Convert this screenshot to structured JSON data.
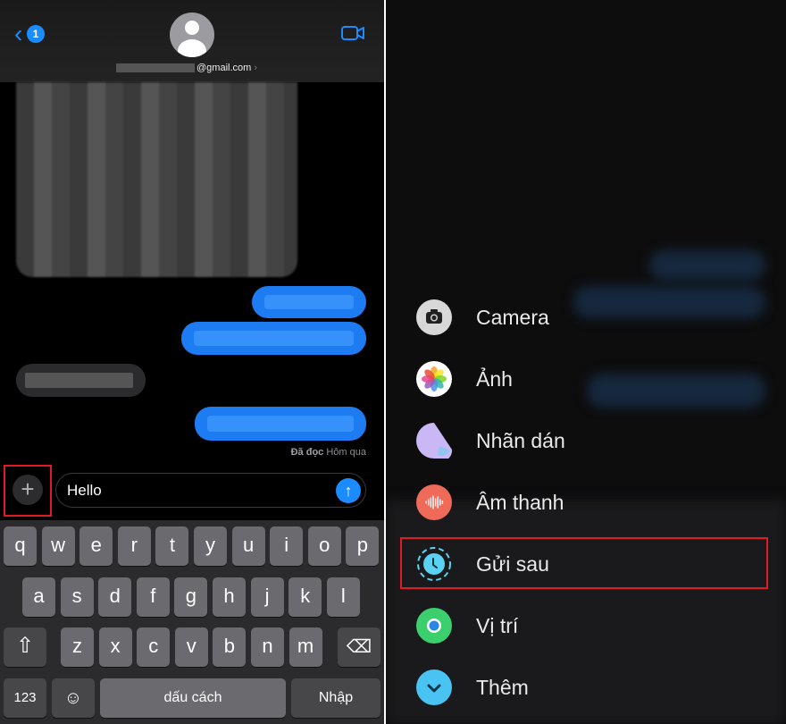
{
  "chat": {
    "back_badge": "1",
    "contact_email": "@gmail.com",
    "read_receipt_label": "Đã đọc",
    "read_receipt_time": "Hôm qua",
    "input_value": "Hello"
  },
  "keyboard": {
    "row1": [
      "q",
      "w",
      "e",
      "r",
      "t",
      "y",
      "u",
      "i",
      "o",
      "p"
    ],
    "row2": [
      "a",
      "s",
      "d",
      "f",
      "g",
      "h",
      "j",
      "k",
      "l"
    ],
    "row3": [
      "z",
      "x",
      "c",
      "v",
      "b",
      "n",
      "m"
    ],
    "numbers_key": "123",
    "space_key": "dấu cách",
    "return_key": "Nhập"
  },
  "apps_menu": {
    "items": [
      {
        "label": "Camera",
        "icon": "camera-icon",
        "color": "#d8d8d8"
      },
      {
        "label": "Ảnh",
        "icon": "photos-icon",
        "color": "#ffffff"
      },
      {
        "label": "Nhãn dán",
        "icon": "sticker-icon",
        "color": "#b9a6f0"
      },
      {
        "label": "Âm thanh",
        "icon": "audio-icon",
        "color": "#ef6a58"
      },
      {
        "label": "Gửi sau",
        "icon": "send-later-icon",
        "color": "#5ad2f4"
      },
      {
        "label": "Vị trí",
        "icon": "location-icon",
        "color": "#3ccf6e"
      },
      {
        "label": "Thêm",
        "icon": "more-icon",
        "color": "#48c3f2"
      }
    ]
  },
  "colors": {
    "accent": "#1a8cff",
    "highlight": "#e01b24"
  }
}
